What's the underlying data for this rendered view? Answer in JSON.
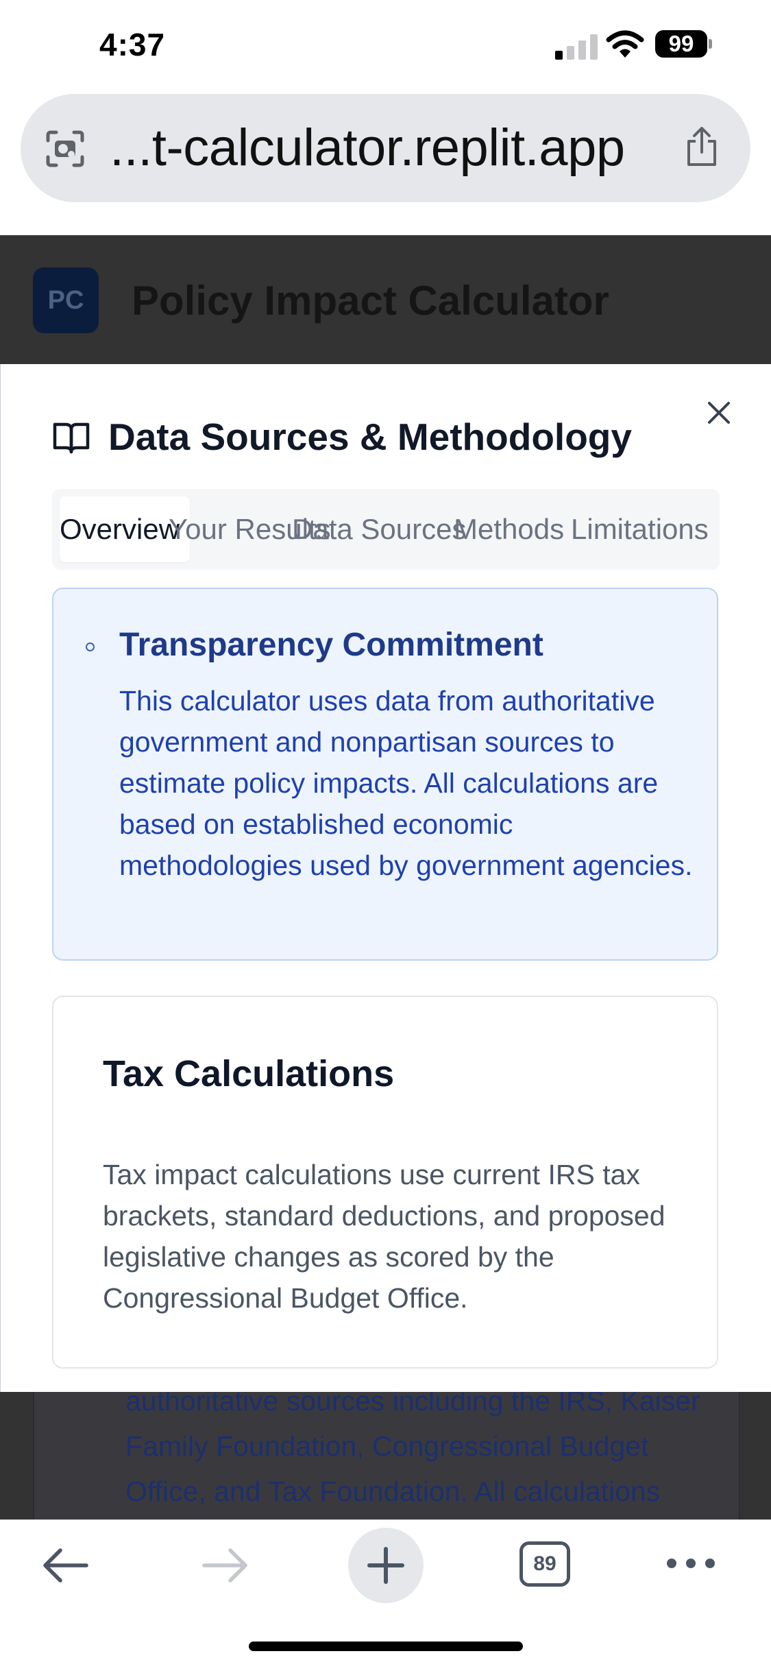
{
  "status_bar": {
    "time": "4:37",
    "battery": "99",
    "signal_bars_active": 1,
    "icons": [
      "cellular-signal-icon",
      "wifi-icon",
      "battery-icon"
    ]
  },
  "browser": {
    "url": "...t-calculator.replit.app",
    "tab_count": "89",
    "icons": [
      "page-settings-icon",
      "share-icon",
      "back-arrow-icon",
      "forward-arrow-icon",
      "new-tab-plus-icon",
      "tab-switcher-icon",
      "more-menu-icon"
    ]
  },
  "app": {
    "logo_text": "PC",
    "title": "Policy Impact Calculator",
    "behind_text": "authoritative sources including the IRS, Kaiser Family Foundation, Congressional Budget Office, and Tax Foundation. All calculations follow established"
  },
  "modal": {
    "title": "Data Sources & Methodology",
    "tabs": [
      {
        "label": "Overview",
        "active": true
      },
      {
        "label": "Your Results",
        "active": false
      },
      {
        "label": "Data Sources",
        "active": false
      },
      {
        "label": "Methods",
        "active": false
      },
      {
        "label": "Limitations",
        "active": false
      }
    ],
    "notice": {
      "title": "Transparency Commitment",
      "body": "This calculator uses data from authoritative government and nonpartisan sources to estimate policy impacts. All calculations are based on established economic methodologies used by government agencies."
    },
    "tax_card": {
      "title": "Tax Calculations",
      "body": "Tax impact calculations use current IRS tax brackets, standard deductions, and proposed legislative changes as scored by the Congressional Budget Office."
    }
  },
  "colors": {
    "accent_blue": "#1e40af",
    "notice_bg": "#eef4fd",
    "overlay": "#333333"
  }
}
